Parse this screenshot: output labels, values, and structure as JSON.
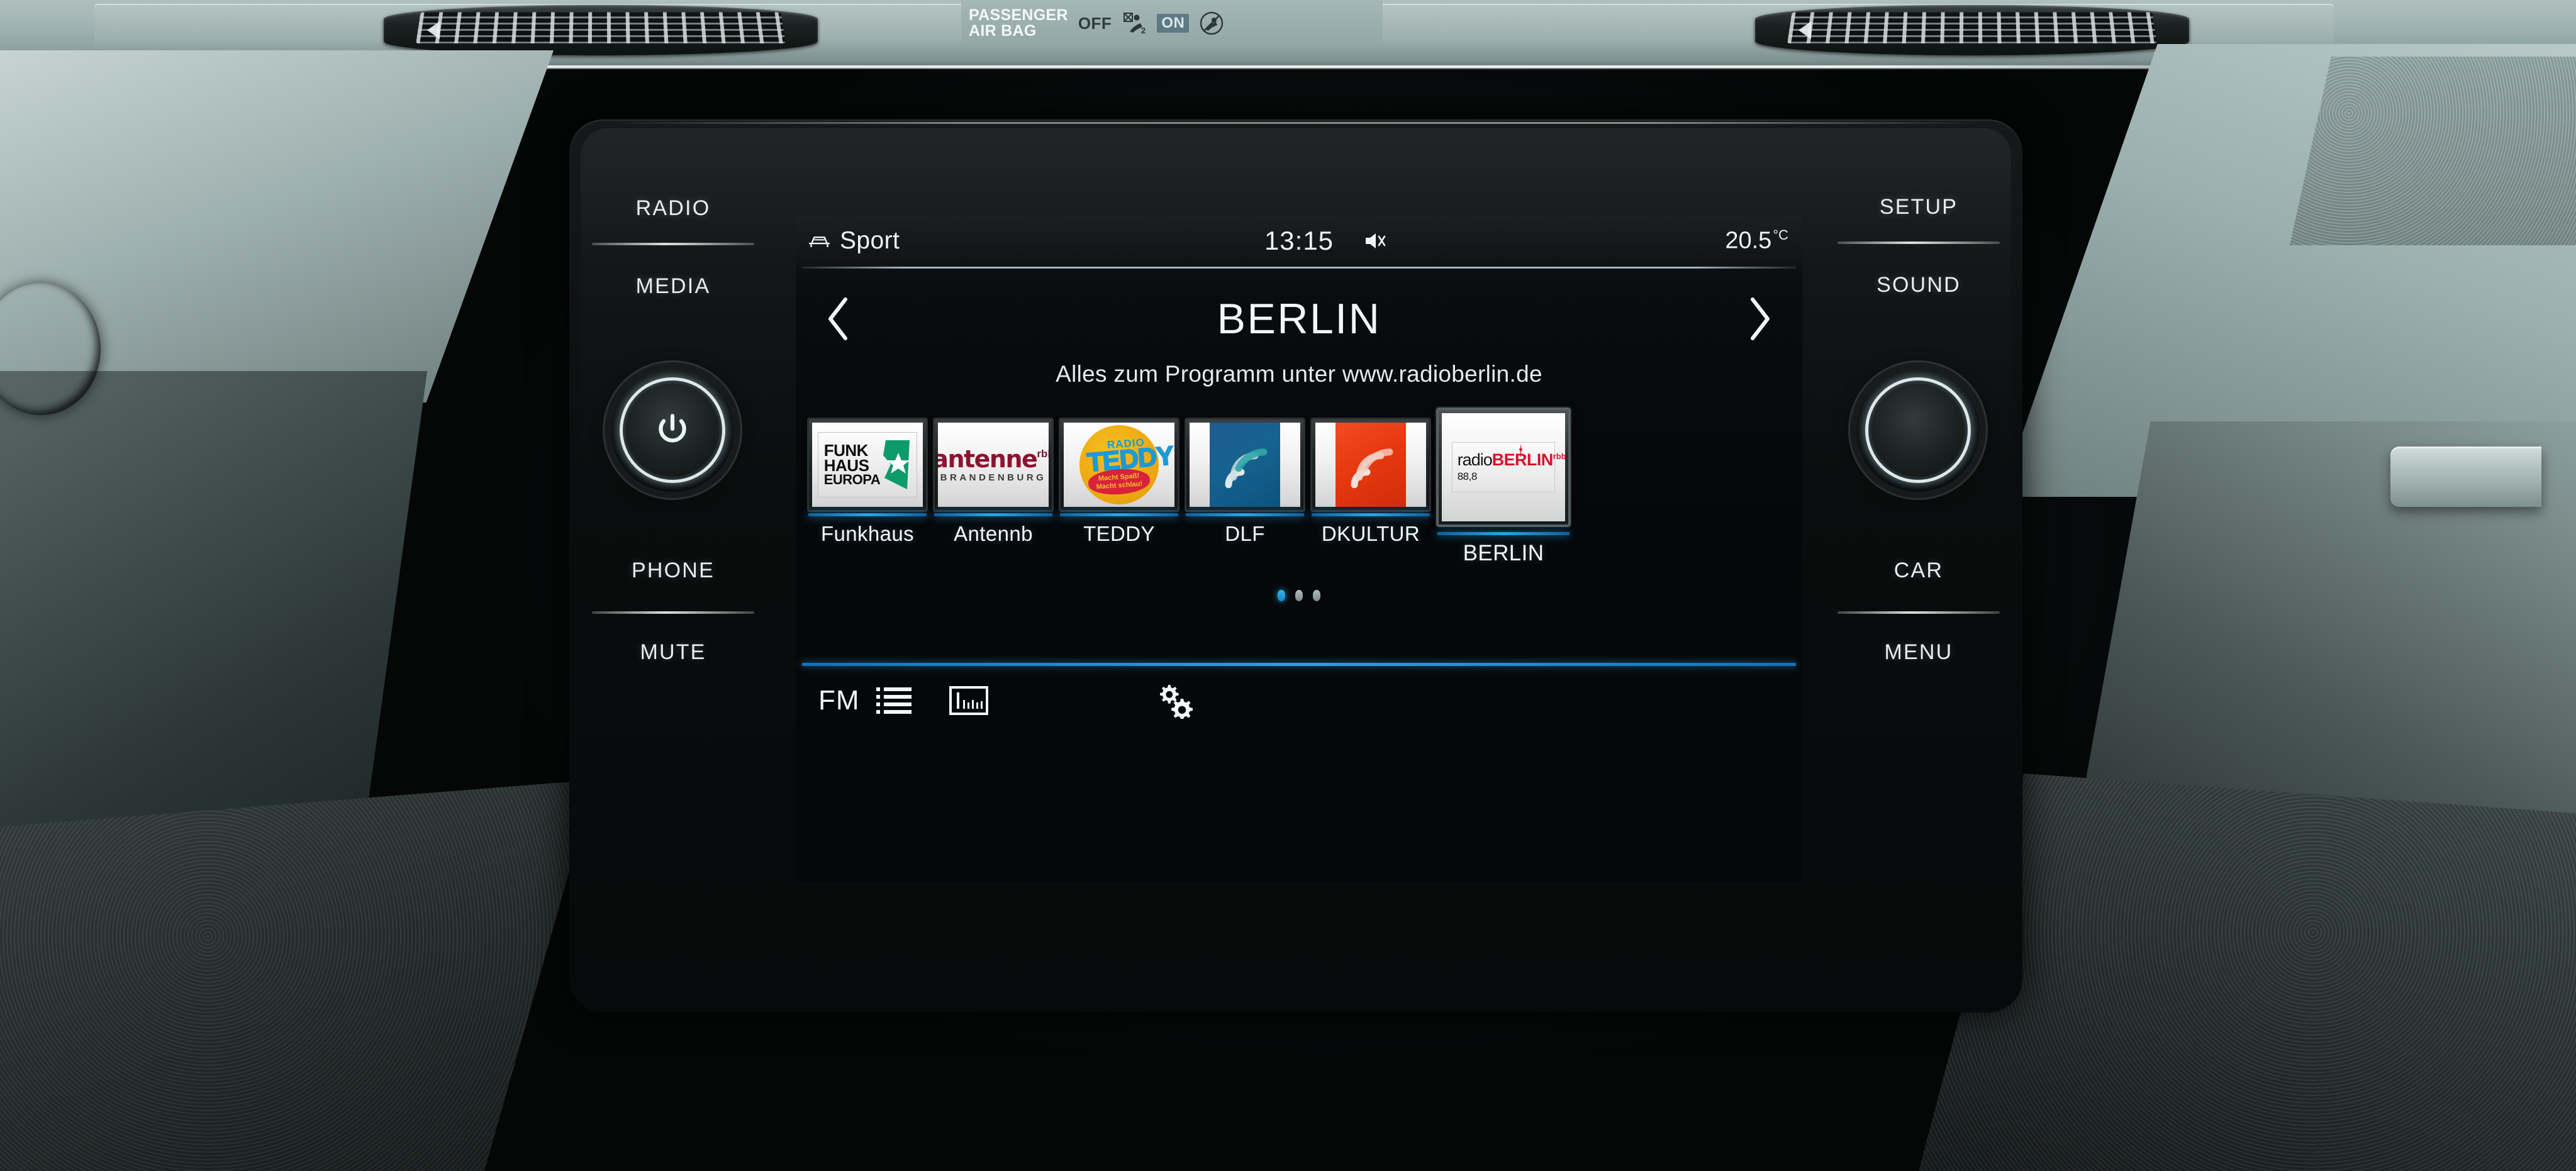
{
  "dashboard": {
    "airbag": {
      "title_line1": "PASSENGER",
      "title_line2": "AIR BAG",
      "off_label": "OFF",
      "on_label": "ON",
      "off_icon": "seat-child-crossed-icon",
      "on_icon": "seat-child-no-icon"
    },
    "vents": {
      "left_name": "air-vent-left",
      "right_name": "air-vent-right"
    }
  },
  "headunit": {
    "left_buttons": [
      {
        "label": "RADIO",
        "name": "radio-button"
      },
      {
        "label": "MEDIA",
        "name": "media-button"
      },
      {
        "label": "PHONE",
        "name": "phone-button"
      },
      {
        "label": "MUTE",
        "name": "mute-button"
      }
    ],
    "right_buttons": [
      {
        "label": "SETUP",
        "name": "setup-button"
      },
      {
        "label": "SOUND",
        "name": "sound-button"
      },
      {
        "label": "CAR",
        "name": "car-button"
      },
      {
        "label": "MENU",
        "name": "menu-button"
      }
    ],
    "left_knob": {
      "name": "power-volume-knob",
      "icon": "power-icon"
    },
    "right_knob": {
      "name": "tuning-knob",
      "icon": "none"
    }
  },
  "screen": {
    "statusbar": {
      "profile_icon": "car-front-icon",
      "profile": "Sport",
      "clock": "13:15",
      "mute_icon": "speaker-mute-icon",
      "temperature": "20.5",
      "temperature_unit": "°C"
    },
    "nav": {
      "prev_icon": "chevron-left-icon",
      "next_icon": "chevron-right-icon",
      "station_title": "BERLIN"
    },
    "radiotext": "Alles zum Programm unter www.radioberlin.de",
    "presets": [
      {
        "label": "Funkhaus",
        "logo": "funkhaus-europa-logo",
        "selected": false,
        "logo_text": {
          "line1": "FUNK",
          "line2": "HAUS",
          "line3": "EUROPA"
        },
        "colors": {
          "mark": "#0d9b6a",
          "text": "#0c0c0c"
        }
      },
      {
        "label": "Antennb",
        "logo": "antenne-brandenburg-logo",
        "selected": false,
        "logo_text": {
          "main": "antenne",
          "sup": "rbb",
          "sub": "BRANDENBURG"
        },
        "colors": {
          "main": "#8e1230",
          "sub": "#3a3a3a"
        }
      },
      {
        "label": "TEDDY",
        "logo": "radio-teddy-logo",
        "selected": false,
        "logo_text": {
          "radio": "RADIO",
          "main": "TEDDY",
          "slogan1": "Macht Spaß!",
          "slogan2": "Macht schlau!"
        },
        "colors": {
          "circle": "#eda80f",
          "text": "#1b9ad6",
          "band": "#d8223c"
        }
      },
      {
        "label": "DLF",
        "logo": "deutschlandfunk-wave-logo",
        "selected": false,
        "colors": {
          "bg": "#15628f",
          "wave": "#dfe9ec"
        }
      },
      {
        "label": "DKULTUR",
        "logo": "deutschlandfunk-kultur-wave-logo",
        "selected": false,
        "colors": {
          "bg": "#e8380f",
          "wave": "#f0dcd6"
        }
      },
      {
        "label": "BERLIN",
        "logo": "radio-berlin-rbb-logo",
        "selected": true,
        "logo_text": {
          "radio": "radio",
          "berlin": "BERLIN",
          "rbb": "rbb",
          "freq": "88,8"
        },
        "colors": {
          "berlin": "#d8122b",
          "radio": "#161616"
        }
      }
    ],
    "pager": {
      "total": 3,
      "active_index": 0
    },
    "bottombar": {
      "band_label": "FM",
      "list_icon": "station-list-icon",
      "tuner_icon": "frequency-band-icon",
      "settings_icon": "gears-settings-icon"
    }
  },
  "colors": {
    "accent_blue": "#2aa3e8",
    "screen_bg": "#05080a",
    "dash_teal": "#9fb2b1"
  }
}
